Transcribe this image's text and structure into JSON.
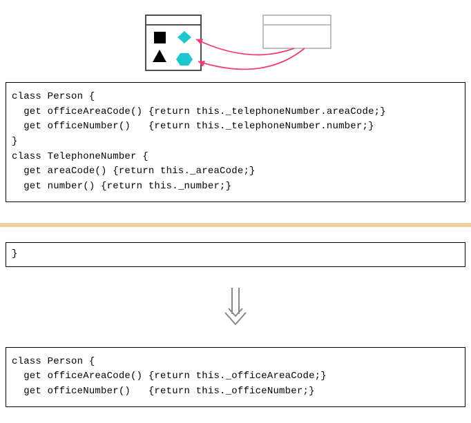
{
  "diagram": {
    "left_box": {
      "fill": "#ffffff",
      "stroke": "#333333"
    },
    "right_box": {
      "fill": "#ffffff",
      "stroke": "#999999"
    },
    "shapes": {
      "square": "#000000",
      "triangle": "#000000",
      "diamond": "#1ec7cf",
      "hexagon": "#1ec7cf"
    },
    "arrow_color": "#ef3d7a"
  },
  "code": {
    "block1": "class Person {\n  get officeAreaCode() {return this._telephoneNumber.areaCode;}\n  get officeNumber()   {return this._telephoneNumber.number;}\n}\nclass TelephoneNumber {\n  get areaCode() {return this._areaCode;}\n  get number() {return this._number;}\n",
    "block2": "}",
    "block3": "class Person {\n  get officeAreaCode() {return this._officeAreaCode;}\n  get officeNumber()   {return this._officeNumber;}"
  }
}
